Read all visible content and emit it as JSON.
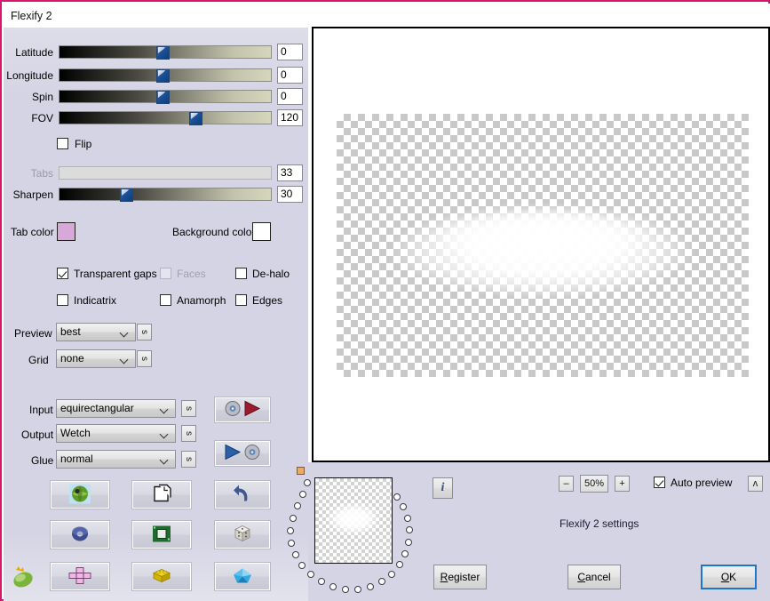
{
  "window": {
    "title": "Flexify 2",
    "border_color": "#d6176b",
    "panel_color": "#d4d4e4"
  },
  "sliders": [
    {
      "label": "Latitude",
      "value": "0",
      "pos_pct": 48,
      "disabled": false
    },
    {
      "label": "Longitude",
      "value": "0",
      "pos_pct": 48,
      "disabled": false
    },
    {
      "label": "Spin",
      "value": "0",
      "pos_pct": 48,
      "disabled": false
    },
    {
      "label": "FOV",
      "value": "120",
      "pos_pct": 64,
      "disabled": false
    },
    {
      "label": "Tabs",
      "value": "33",
      "pos_pct": 0,
      "disabled": true
    },
    {
      "label": "Sharpen",
      "value": "30",
      "pos_pct": 30,
      "disabled": false
    }
  ],
  "flip": {
    "label": "Flip",
    "checked": false
  },
  "colors": {
    "tab_color_label": "Tab color",
    "tab_color_value": "#d8a8d8",
    "background_color_label": "Background color",
    "background_color_value": "#ffffff"
  },
  "checkboxes": [
    {
      "label": "Transparent gaps",
      "checked": true,
      "disabled": false
    },
    {
      "label": "Faces",
      "checked": false,
      "disabled": true
    },
    {
      "label": "De-halo",
      "checked": false,
      "disabled": false
    },
    {
      "label": "Indicatrix",
      "checked": false,
      "disabled": false
    },
    {
      "label": "Anamorph",
      "checked": false,
      "disabled": false
    },
    {
      "label": "Edges",
      "checked": false,
      "disabled": false
    }
  ],
  "dropdowns": [
    {
      "label": "Preview",
      "value": "best",
      "side_button": "s"
    },
    {
      "label": "Grid",
      "value": "none",
      "side_button": "s"
    },
    {
      "label": "Input",
      "value": "equirectangular",
      "side_button": "s"
    },
    {
      "label": "Output",
      "value": "Wetch",
      "side_button": "s"
    },
    {
      "label": "Glue",
      "value": "normal",
      "side_button": "s"
    }
  ],
  "transfer_buttons": [
    {
      "name": "load-input-preset",
      "icon": "disc-play-icon"
    },
    {
      "name": "save-output-preset",
      "icon": "play-disc-icon"
    }
  ],
  "shape_buttons": [
    {
      "name": "globe-button",
      "icon": "globe-icon"
    },
    {
      "name": "pages-button",
      "icon": "pages-icon"
    },
    {
      "name": "undo-button",
      "icon": "undo-arrow-icon"
    },
    {
      "name": "torus-button",
      "icon": "torus-icon"
    },
    {
      "name": "square-button",
      "icon": "green-square-icon"
    },
    {
      "name": "dice-button",
      "icon": "dice-icon"
    },
    {
      "name": "cross-net-button",
      "icon": "cross-net-icon"
    },
    {
      "name": "brick-button",
      "icon": "yellow-brick-icon"
    },
    {
      "name": "gem-button",
      "icon": "blue-gem-icon"
    }
  ],
  "corner_icon": {
    "name": "flexify-leaf-icon"
  },
  "bottom": {
    "info_button": "i",
    "zoom_out": "–",
    "zoom_level": "50%",
    "zoom_in": "+",
    "auto_preview_label": "Auto preview",
    "auto_preview_checked": true,
    "collapse_button": "ʌ",
    "settings_text": "Flexify 2 settings",
    "register_button": "Register",
    "register_accel": "R",
    "cancel_button": "Cancel",
    "cancel_accel": "C",
    "ok_button": "OK",
    "ok_accel": "O"
  }
}
